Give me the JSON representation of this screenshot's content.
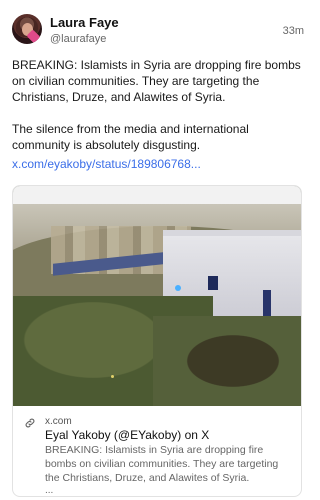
{
  "author": {
    "name": "Laura Faye",
    "handle": "@laurafaye",
    "timestamp": "33m"
  },
  "post": {
    "paragraphs": [
      "BREAKING: Islamists in Syria are dropping fire bombs on civilian communities. They are targeting the Christians, Druze, and Alawites of Syria.",
      "The silence from the media and international community is absolutely disgusting."
    ],
    "link": "x.com/eyakoby/status/189806768..."
  },
  "card": {
    "domain": "x.com",
    "title": "Eyal Yakoby (@EYakoby) on X",
    "description": "BREAKING: Islamists in Syria are dropping fire bombs on civilian communities. They are targeting the Christians, Druze, and Alawites of Syria.",
    "ellipsis": "...",
    "watermark_icon": "globe-icon"
  },
  "colors": {
    "link": "#3b6ee8",
    "text": "#1a1a1a",
    "muted": "#666666"
  }
}
